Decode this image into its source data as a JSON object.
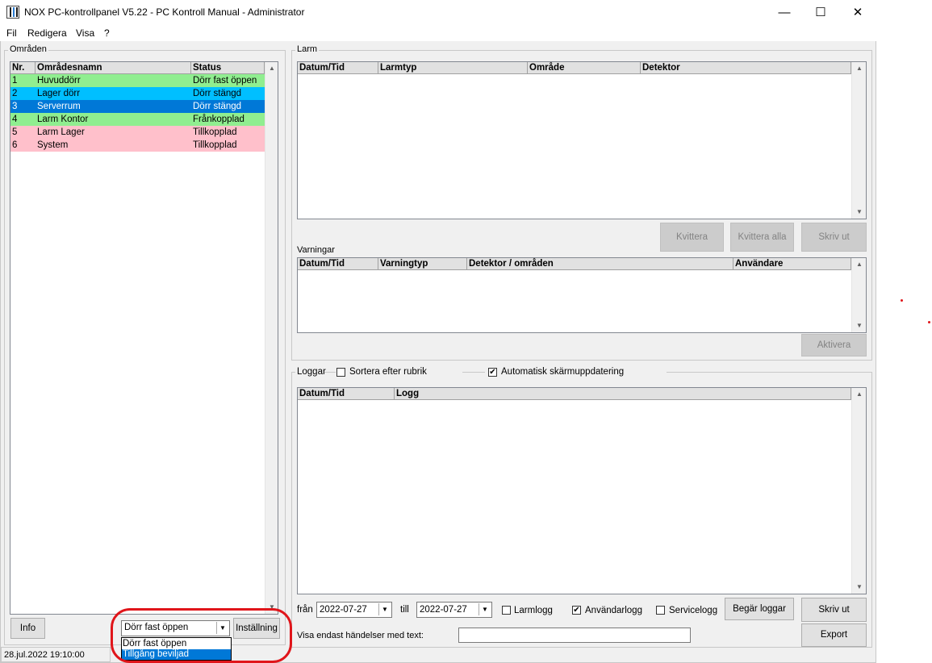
{
  "window": {
    "title": "NOX PC-kontrollpanel V5.22 - PC Kontroll Manual - Administrator",
    "minimize": "—",
    "maximize": "☐",
    "close": "✕"
  },
  "menu": [
    "Fil",
    "Redigera",
    "Visa",
    "?"
  ],
  "areas": {
    "label": "Områden",
    "columns": [
      "Nr.",
      "Områdesnamn",
      "Status"
    ],
    "rows": [
      {
        "nr": "1",
        "name": "Huvuddörr",
        "status": "Dörr fast öppen",
        "bg": "#90ee90",
        "fg": "#000000"
      },
      {
        "nr": "2",
        "name": "Lager dörr",
        "status": "Dörr stängd",
        "bg": "#00bfff",
        "fg": "#000000"
      },
      {
        "nr": "3",
        "name": "Serverrum",
        "status": "Dörr stängd",
        "bg": "#0078d7",
        "fg": "#ffffff"
      },
      {
        "nr": "4",
        "name": "Larm Kontor",
        "status": "Frånkopplad",
        "bg": "#90ee90",
        "fg": "#000000"
      },
      {
        "nr": "5",
        "name": "Larm Lager",
        "status": "Tillkopplad",
        "bg": "#ffc0cb",
        "fg": "#000000"
      },
      {
        "nr": "6",
        "name": "System",
        "status": "Tillkopplad",
        "bg": "#ffc0cb",
        "fg": "#000000"
      }
    ],
    "info_button": "Info",
    "combo_value": "Dörr fast öppen",
    "settings_button": "Inställning",
    "dropdown_options": [
      "Dörr fast öppen",
      "Tillgång beviljad"
    ],
    "dropdown_selected": "Tillgång beviljad"
  },
  "alarms": {
    "label": "Larm",
    "columns": [
      "Datum/Tid",
      "Larmtyp",
      "Område",
      "Detektor"
    ],
    "buttons": [
      "Kvittera",
      "Kvittera alla",
      "Skriv ut"
    ]
  },
  "warnings": {
    "label": "Varningar",
    "columns": [
      "Datum/Tid",
      "Varningtyp",
      "Detektor / områden",
      "Användare"
    ],
    "activate_button": "Aktivera"
  },
  "logs": {
    "label": "Loggar",
    "sort_label": "Sortera efter rubrik",
    "sort_checked": false,
    "auto_label": "Automatisk skärmuppdatering",
    "auto_checked": true,
    "columns": [
      "Datum/Tid",
      "Logg"
    ],
    "from_label": "från",
    "from_date": "2022-07-27",
    "to_label": "till",
    "to_date": "2022-07-27",
    "alarm_log_label": "Larmlogg",
    "alarm_log_checked": false,
    "user_log_label": "Användarlogg",
    "user_log_checked": true,
    "service_log_label": "Servicelogg",
    "service_log_checked": false,
    "request_button": "Begär loggar",
    "print_button": "Skriv ut",
    "filter_label": "Visa endast händelser med text:",
    "filter_value": "",
    "export_button": "Export"
  },
  "status_bar": {
    "datetime": "28.jul.2022  19:10:00"
  },
  "annotation_color": "#e0151a"
}
